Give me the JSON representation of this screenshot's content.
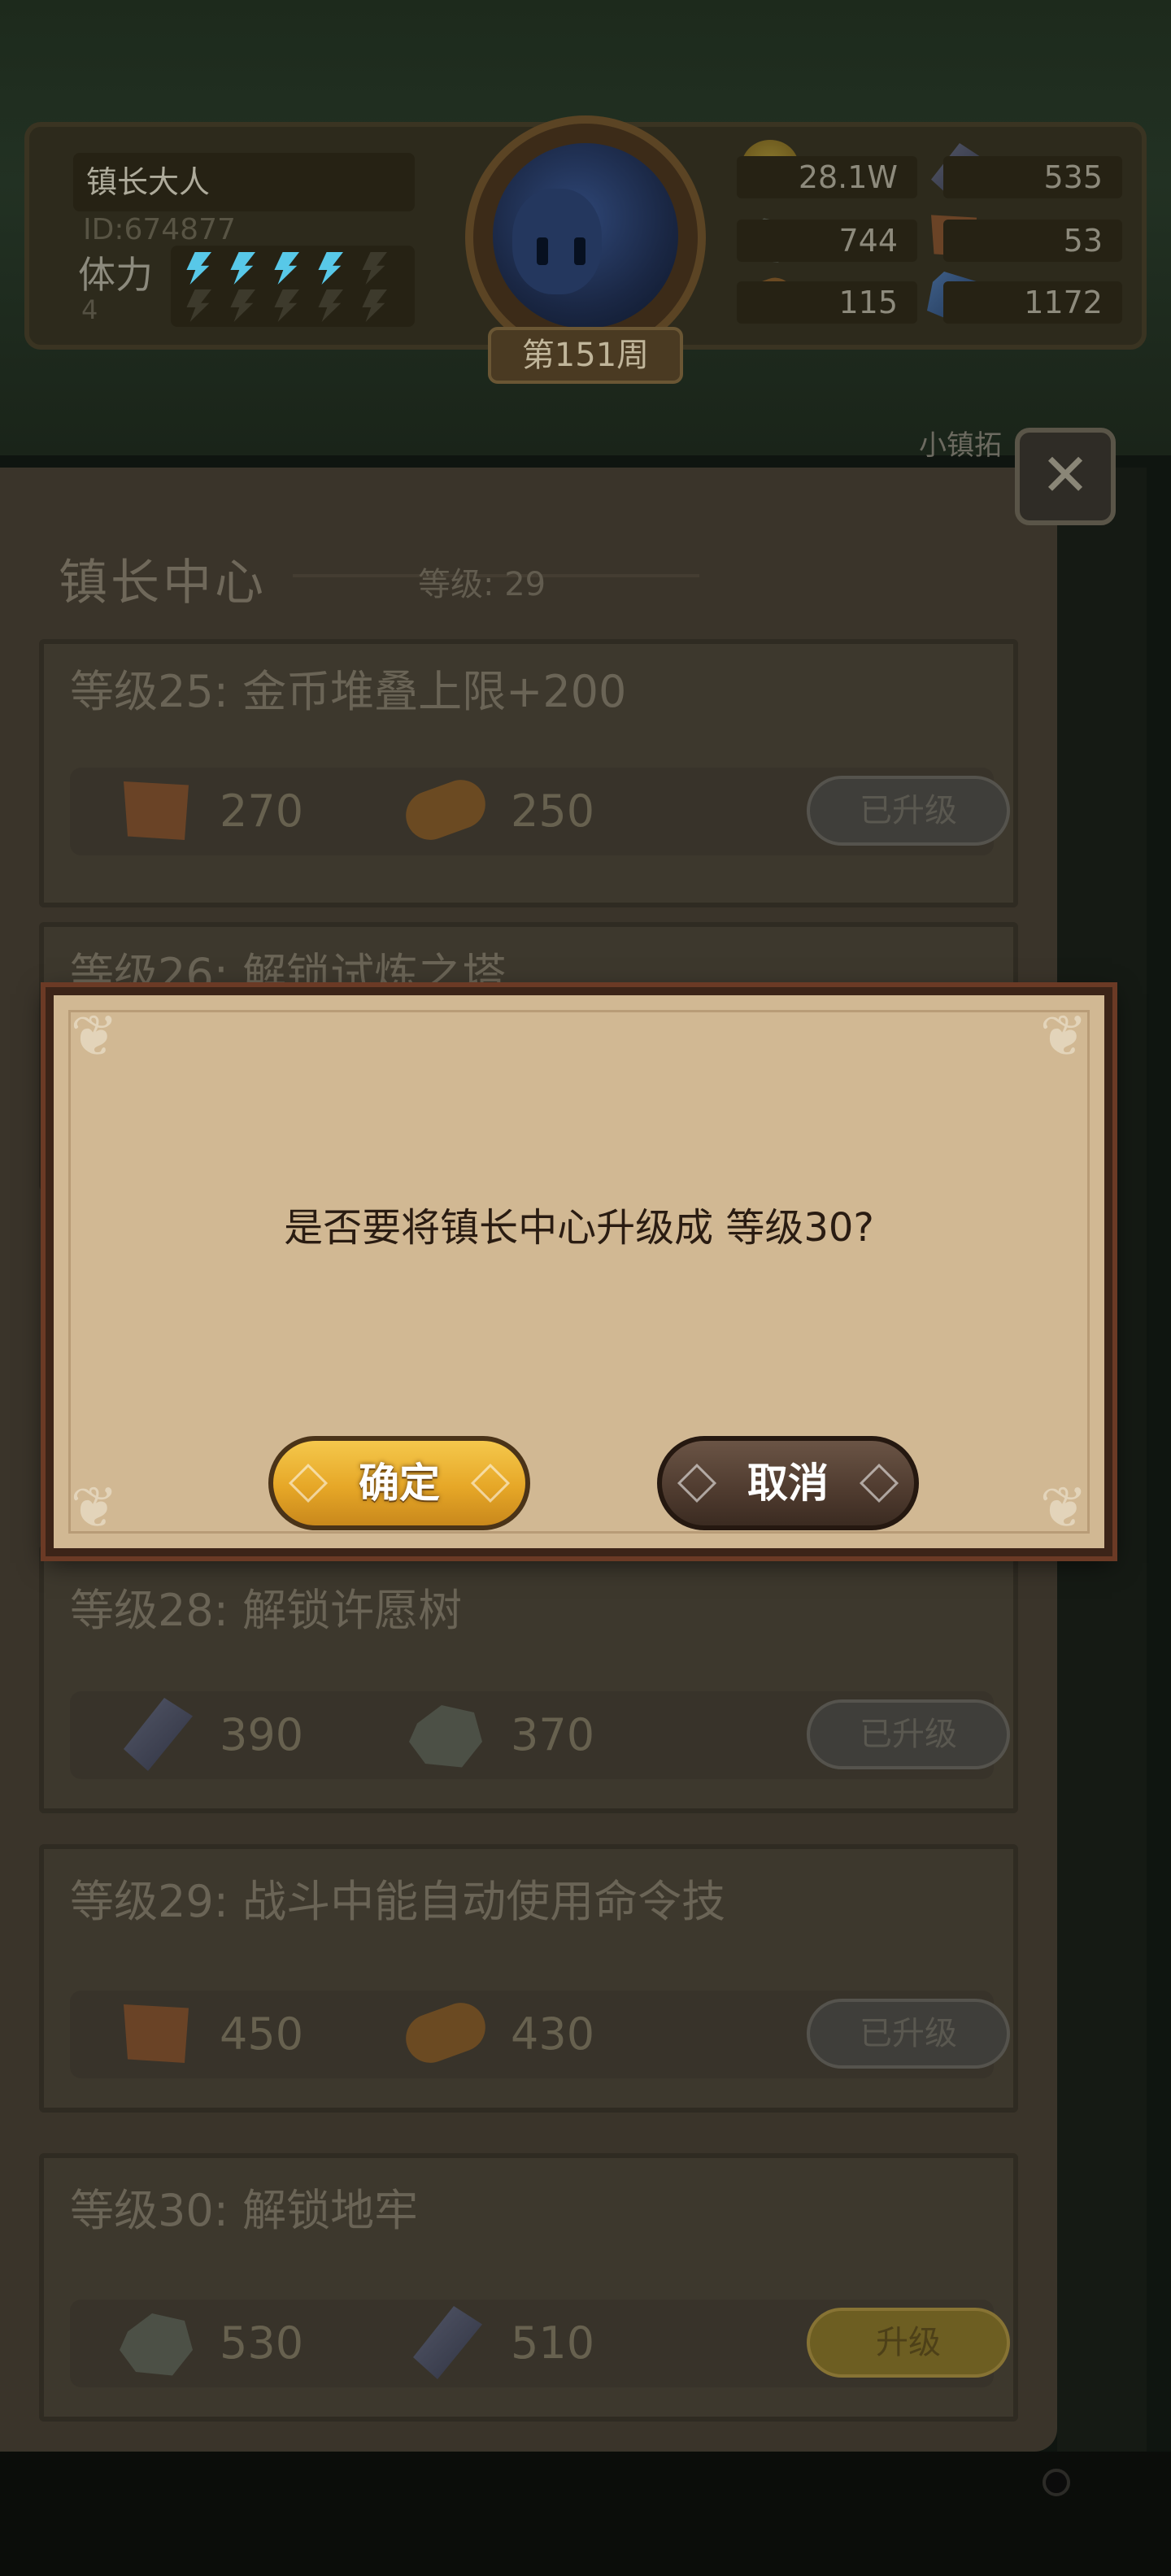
{
  "header": {
    "player_name": "镇长大人",
    "player_id": "ID:674877",
    "stamina_label": "体力",
    "stamina_value": "4",
    "stamina_current": 4,
    "stamina_max": 10,
    "week_label": "第151周",
    "resources": {
      "gold": "28.1W",
      "iron": "535",
      "stone": "744",
      "leather": "53",
      "wood": "115",
      "crystal": "1172"
    },
    "side_tab_partial": "小镇拓"
  },
  "panel": {
    "title": "镇长中心",
    "level_label": "等级: 29",
    "close_icon": "hammer-cross-icon"
  },
  "cards": [
    {
      "title": "等级25: 金币堆叠上限+200",
      "cost1_icon": "leather-icon",
      "cost1": "270",
      "cost2_icon": "wood-log-icon",
      "cost2": "250",
      "button": "已升级"
    },
    {
      "title": "等级26: 解锁试炼之塔",
      "cost1_icon": "",
      "cost1": "",
      "cost2_icon": "",
      "cost2": "",
      "button": ""
    },
    {
      "title": "等级28: 解锁许愿树",
      "cost1_icon": "iron-ingot-icon",
      "cost1": "390",
      "cost2_icon": "stone-icon",
      "cost2": "370",
      "button": "已升级"
    },
    {
      "title": "等级29: 战斗中能自动使用命令技",
      "cost1_icon": "leather-icon",
      "cost1": "450",
      "cost2_icon": "wood-log-icon",
      "cost2": "430",
      "button": "已升级"
    },
    {
      "title": "等级30: 解锁地牢",
      "cost1_icon": "stone-icon",
      "cost1": "530",
      "cost2_icon": "iron-ingot-icon",
      "cost2": "510",
      "button": "升级"
    }
  ],
  "dialog": {
    "message": "是否要将镇长中心升级成 等级30?",
    "confirm": "确定",
    "cancel": "取消"
  },
  "colors": {
    "confirm_gold": "#f0b93c",
    "cancel_brown": "#4f3b2f",
    "dialog_parchment": "#d1b893",
    "stamina_blue": "#58c8e8"
  }
}
